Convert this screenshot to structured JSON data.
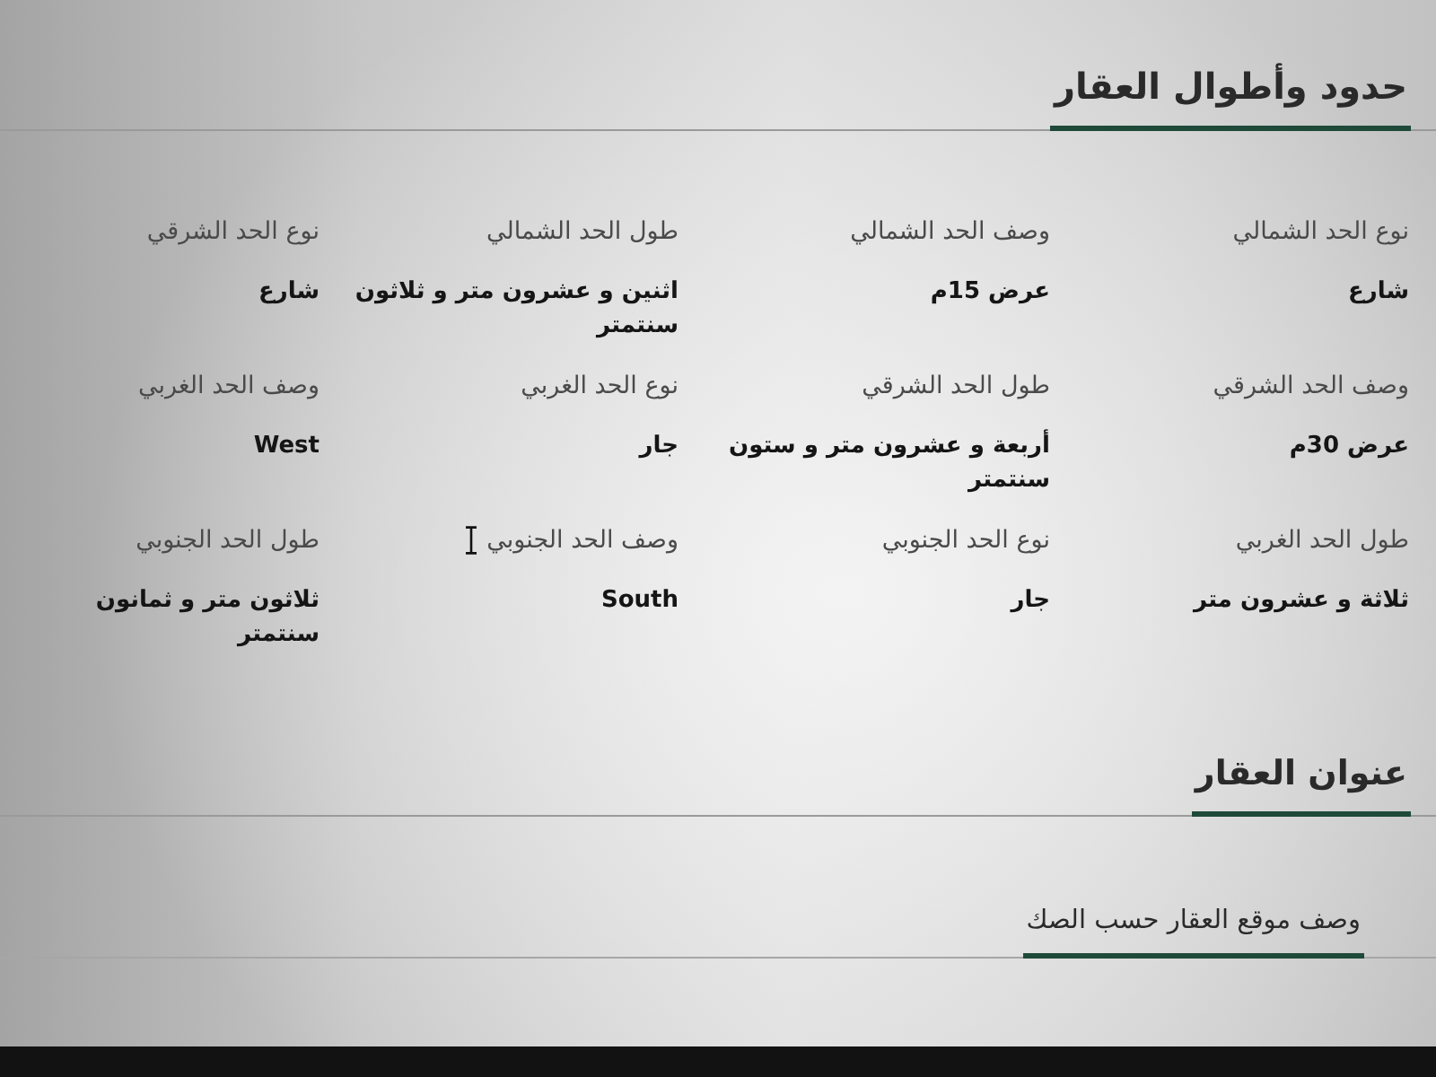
{
  "boundaries_section": {
    "title": "حدود وأطوال العقار",
    "fields": [
      {
        "label": "نوع الحد الشمالي",
        "value": "شارع"
      },
      {
        "label": "وصف الحد الشمالي",
        "value": "عرض 15م"
      },
      {
        "label": "طول الحد الشمالي",
        "value": "اثنين و عشرون متر و ثلاثون سنتمتر"
      },
      {
        "label": "نوع الحد الشرقي",
        "value": "شارع"
      },
      {
        "label": "وصف الحد الشرقي",
        "value": "عرض 30م"
      },
      {
        "label": "طول الحد الشرقي",
        "value": "أربعة و عشرون متر و ستون سنتمتر"
      },
      {
        "label": "نوع الحد الغربي",
        "value": "جار"
      },
      {
        "label": "وصف الحد الغربي",
        "value": "West"
      },
      {
        "label": "طول الحد الغربي",
        "value": "ثلاثة و عشرون متر"
      },
      {
        "label": "نوع الحد الجنوبي",
        "value": "جار"
      },
      {
        "label": "وصف الحد الجنوبي",
        "value": "South"
      },
      {
        "label": "طول الحد الجنوبي",
        "value": "ثلاثون متر و ثمانون سنتمتر"
      }
    ]
  },
  "address_section": {
    "title": "عنوان العقار",
    "tabs": [
      {
        "label": "وصف موقع العقار حسب الصك",
        "selected": true
      }
    ]
  }
}
